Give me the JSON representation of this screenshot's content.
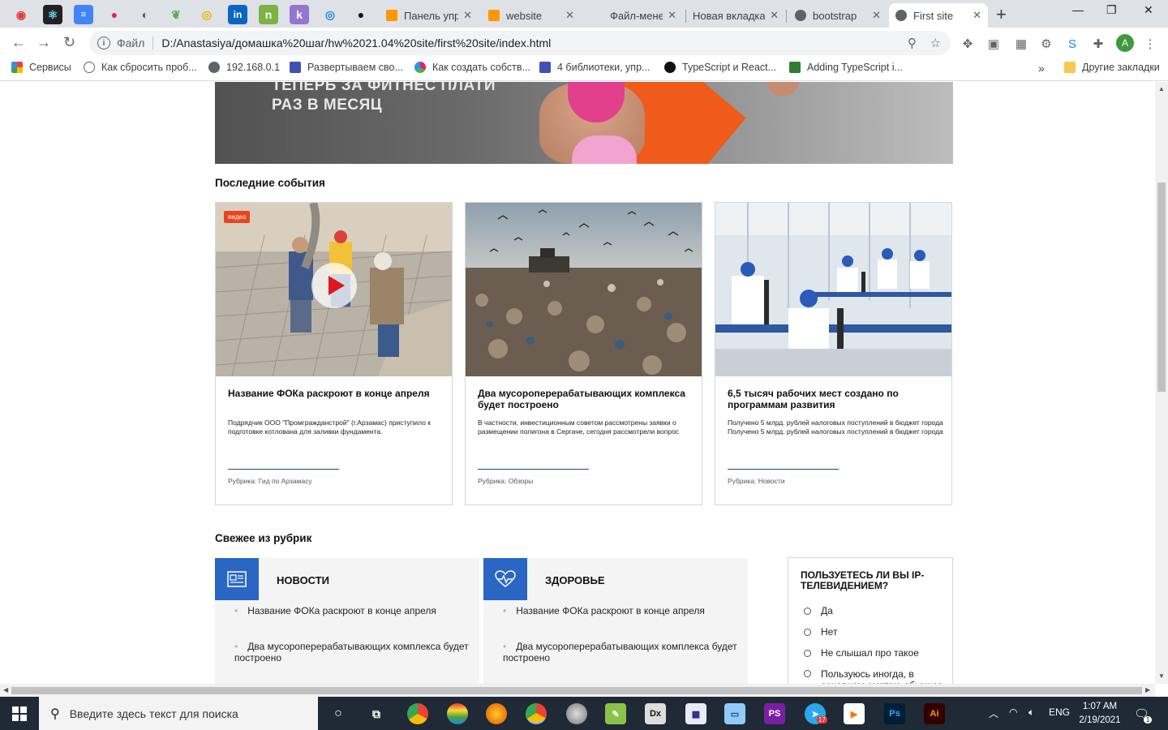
{
  "browser": {
    "tabs": [
      {
        "label": "Панель упр",
        "active": false
      },
      {
        "label": "website",
        "active": false
      },
      {
        "label": "Файл-мене",
        "active": false
      },
      {
        "label": "Новая вкладка",
        "active": false
      },
      {
        "label": "bootstrap",
        "active": false
      },
      {
        "label": "First site",
        "active": true
      }
    ],
    "address_scheme": "Файл",
    "address_url": "D:/Anastasiya/домашка%20шаг/hw%2021.04%20site/first%20site/index.html",
    "profile_initial": "A",
    "bookmarks": [
      "Сервисы",
      "Как сбросить проб...",
      "192.168.0.1",
      "Развертываем сво...",
      "Как создать собств...",
      "4 библиотеки, упр...",
      "TypeScript и React...",
      "Adding TypeScript i..."
    ],
    "bookmarks_overflow": "»",
    "other_bookmarks": "Другие закладки"
  },
  "banner": {
    "line1": "ТЕПЕРЬ ЗА ФИТНЕС ПЛАТИ",
    "line2": "РАЗ В МЕСЯЦ"
  },
  "events": {
    "title": "Последние события",
    "cards": [
      {
        "badge": "видео",
        "title": "Название ФОКа раскроют в конце апреля",
        "desc": "Подрядчик ООО \"Промгражданстрой\" (г.Арзамас) приступило к подготовке котлована для заливки фундамента.",
        "rubric": "Рубрика: Гид по Арзамасу"
      },
      {
        "title": "Два мусороперерабатывающих комплекса будет построено",
        "desc": "В частности, инвестиционным советом рассмотрены заявки о размещении полигона в Сергаче, сегодня рассмотрели вопрос",
        "rubric": "Рубрика: Обзоры"
      },
      {
        "title": "6,5 тысяч рабочих мест создано по программам развития",
        "desc": "Получено 5 млрд. рублей налоговых поступлений в бюджет города Получено 5 млрд. рублей налоговых поступлений в бюджет города",
        "rubric": "Рубрика: Новости"
      }
    ]
  },
  "rubrics": {
    "title": "Свежее из рубрик",
    "blocks": [
      {
        "name": "НОВОСТИ",
        "icon": "newspaper-icon",
        "items": [
          "Название ФОКа раскроют в конце апреля",
          "Два мусороперерабатывающих комплекса будет построено"
        ]
      },
      {
        "name": "ЗДОРОВЬЕ",
        "icon": "heart-pulse-icon",
        "items": [
          "Название ФОКа раскроют в конце апреля",
          "Два мусороперерабатывающих комплекса будет построено"
        ]
      }
    ]
  },
  "poll": {
    "question": "ПОЛЬЗУЕТЕСЬ ЛИ ВЫ IP-ТЕЛЕВИДЕНИЕМ?",
    "options": [
      "Да",
      "Нет",
      "Не слышал про такое",
      "Пользуюсь иногда, в основном смотрю обычное ТВ"
    ]
  },
  "taskbar": {
    "search_placeholder": "Введите здесь текст для поиска",
    "lang": "ENG",
    "time": "1:07 AM",
    "date": "2/19/2021",
    "telegram_badge": "17",
    "notification_count": "1"
  },
  "colors": {
    "accent_blue": "#2a66c4",
    "badge_red": "#e9431d",
    "rubric_line": "#1f4e8c"
  }
}
